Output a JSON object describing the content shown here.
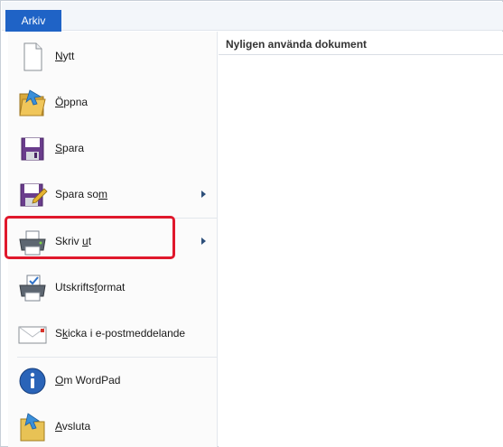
{
  "ribbon": {
    "tab_label": "Arkiv"
  },
  "recent": {
    "title": "Nyligen använda dokument"
  },
  "menu": {
    "items": [
      {
        "pre": "",
        "u": "N",
        "post": "ytt",
        "icon": "new-document-icon",
        "submenu": false
      },
      {
        "pre": "",
        "u": "Ö",
        "post": "ppna",
        "icon": "open-folder-icon",
        "submenu": false
      },
      {
        "pre": "",
        "u": "S",
        "post": "para",
        "icon": "save-floppy-icon",
        "submenu": false
      },
      {
        "pre": "Spara so",
        "u": "m",
        "post": "",
        "icon": "save-as-icon",
        "submenu": true
      },
      {
        "pre": "Skriv ",
        "u": "u",
        "post": "t",
        "icon": "printer-icon",
        "submenu": true
      },
      {
        "pre": "Utskrifts",
        "u": "f",
        "post": "ormat",
        "icon": "page-setup-icon",
        "submenu": false
      },
      {
        "pre": "S",
        "u": "k",
        "post": "icka i e-postmeddelande",
        "icon": "email-envelope-icon",
        "submenu": false
      },
      {
        "pre": "",
        "u": "O",
        "post": "m WordPad",
        "icon": "info-icon",
        "submenu": false
      },
      {
        "pre": "",
        "u": "A",
        "post": "vsluta",
        "icon": "exit-icon",
        "submenu": false
      }
    ]
  },
  "highlight": {
    "target": "Skriv ut",
    "color": "#e0182c"
  }
}
